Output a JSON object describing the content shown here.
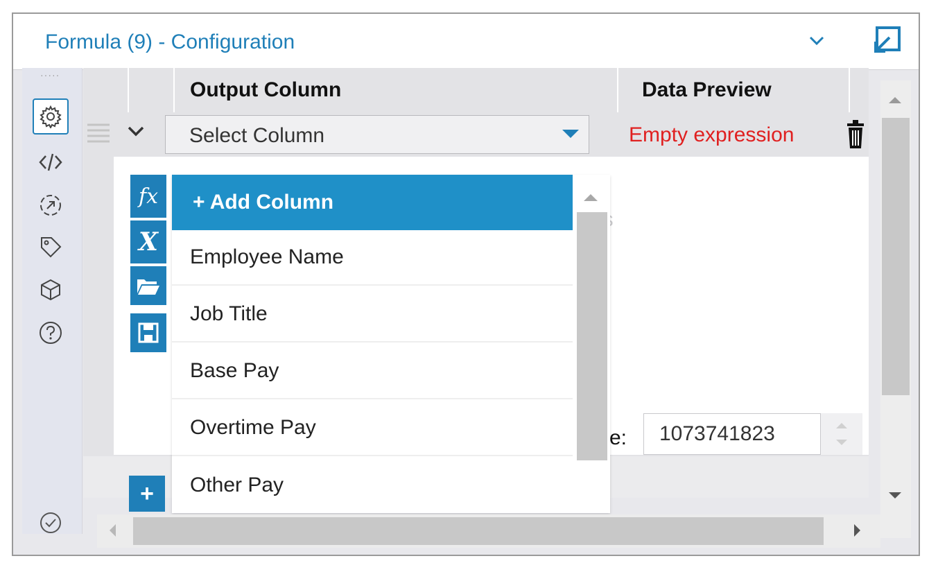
{
  "window": {
    "title": "Formula (9) - Configuration"
  },
  "sidebar": {
    "items": [
      {
        "icon": "gear-icon",
        "active": true
      },
      {
        "icon": "code-icon",
        "active": false
      },
      {
        "icon": "target-icon",
        "active": false
      },
      {
        "icon": "tag-icon",
        "active": false
      },
      {
        "icon": "cube-icon",
        "active": false
      },
      {
        "icon": "help-icon",
        "active": false
      },
      {
        "icon": "check-circle-icon",
        "active": false
      }
    ]
  },
  "grid": {
    "headers": {
      "output_column": "Output Column",
      "data_preview": "Data Preview"
    },
    "row": {
      "select_value": "Select Column",
      "preview": "Empty expression"
    },
    "ghost_text": "ns",
    "size_label": "ze:",
    "size_value": "1073741823"
  },
  "dropdown": {
    "options": [
      "+ Add Column",
      "Employee Name",
      "Job Title",
      "Base Pay",
      "Overtime Pay",
      "Other Pay"
    ],
    "selected_index": 0
  },
  "side_buttons": [
    "fx-icon",
    "variable-icon",
    "folder-open-icon",
    "save-icon"
  ],
  "colors": {
    "accent": "#1f7fb8",
    "selected": "#1f90c8",
    "error": "#e02020"
  }
}
